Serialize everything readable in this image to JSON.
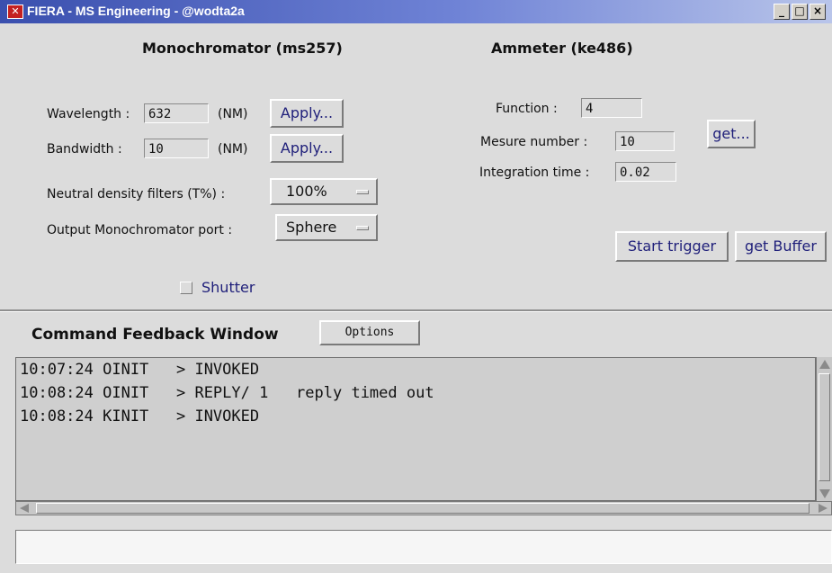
{
  "window": {
    "title": "FIERA - MS Engineering - @wodta2a",
    "icon": "x-logo-icon",
    "controls": [
      "_",
      "□",
      "×"
    ]
  },
  "monochromator": {
    "title": "Monochromator (ms257)",
    "wavelength_label": "Wavelength :",
    "wavelength_value": "632",
    "wavelength_unit": "(NM)",
    "bandwidth_label": "Bandwidth :",
    "bandwidth_value": "10",
    "bandwidth_unit": "(NM)",
    "apply_label": "Apply...",
    "nd_label": "Neutral density filters (T%) :",
    "nd_value": "100%",
    "port_label": "Output Monochromator port :",
    "port_value": "Sphere",
    "shutter_label": "Shutter"
  },
  "ammeter": {
    "title": "Ammeter (ke486)",
    "function_label": "Function :",
    "function_value": "4",
    "mesure_label": "Mesure number :",
    "mesure_value": "10",
    "integration_label": "Integration time :",
    "integration_value": "0.02",
    "get_label": "get...",
    "start_trigger_label": "Start trigger",
    "get_buffer_label": "get Buffer"
  },
  "command_feedback": {
    "title": "Command Feedback Window",
    "options_label": "Options",
    "lines": [
      "10:07:24 OINIT   > INVOKED",
      "10:08:24 OINIT   > REPLY/ 1   reply timed out",
      "10:08:24 KINIT   > INVOKED"
    ],
    "input_value": ""
  }
}
